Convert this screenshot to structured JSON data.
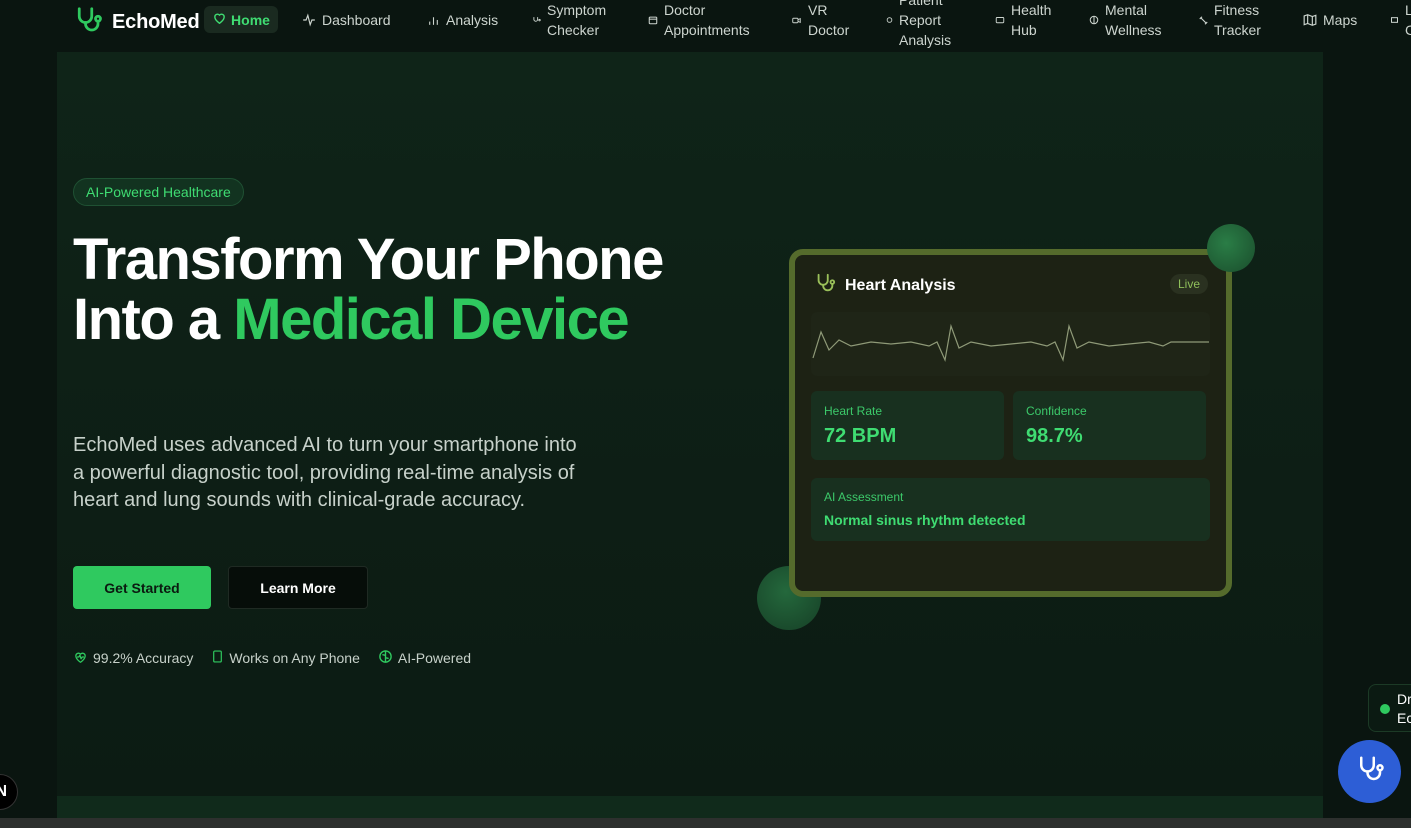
{
  "brand": {
    "name": "EchoMed"
  },
  "nav": {
    "home": "Home",
    "items": [
      {
        "label": "Dashboard",
        "icon": "activity-icon"
      },
      {
        "label": "Analysis",
        "icon": "bar-chart-icon"
      },
      {
        "label": "Symptom Checker",
        "icon": "stethoscope-icon"
      },
      {
        "label": "Doctor Appointments",
        "icon": "calendar-icon"
      },
      {
        "label": "VR Doctor",
        "icon": "video-icon"
      },
      {
        "label": "Patient Report Analysis",
        "icon": "file-icon"
      },
      {
        "label": "Health Hub",
        "icon": "monitor-icon"
      },
      {
        "label": "Mental Wellness",
        "icon": "brain-icon"
      },
      {
        "label": "Fitness Tracker",
        "icon": "dumbbell-icon"
      },
      {
        "label": "Maps",
        "icon": "map-icon"
      },
      {
        "label": "L C",
        "icon": "book-icon"
      }
    ]
  },
  "hero": {
    "badge": "AI-Powered Healthcare",
    "headline_part1": "Transform Your Phone Into a ",
    "headline_accent": "Medical Device",
    "subtext": "EchoMed uses advanced AI to turn your smartphone into a powerful diagnostic tool, providing real-time analysis of heart and lung sounds with clinical-grade accuracy.",
    "primary_button": "Get Started",
    "secondary_button": "Learn More",
    "features": [
      {
        "label": "99.2% Accuracy",
        "icon": "heart-pulse-icon"
      },
      {
        "label": "Works on Any Phone",
        "icon": "smartphone-icon"
      },
      {
        "label": "AI-Powered",
        "icon": "brain-icon"
      }
    ]
  },
  "card": {
    "title": "Heart Analysis",
    "status": "Live",
    "heart_rate_label": "Heart Rate",
    "heart_rate_value": "72 BPM",
    "confidence_label": "Confidence",
    "confidence_value": "98.7%",
    "assessment_label": "AI Assessment",
    "assessment_value": "Normal sinus rhythm detected"
  },
  "floating": {
    "mini_panel_text": "Dr Ec",
    "next_badge": "N"
  },
  "colors": {
    "accent": "#2fc95f",
    "background": "#0a1510",
    "card_border": "#556b2c",
    "fab": "#2d5ed6"
  }
}
